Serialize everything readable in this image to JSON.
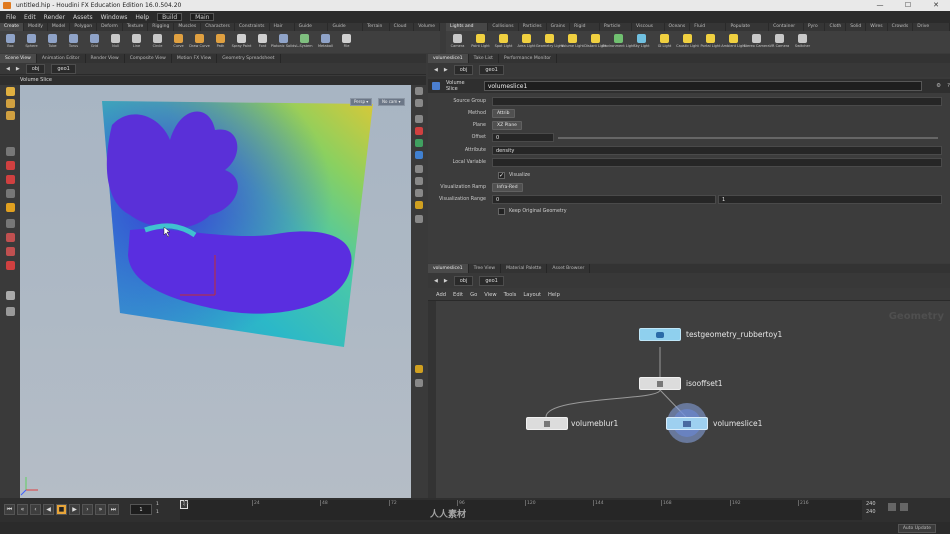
{
  "window": {
    "title": "untitled.hip - Houdini FX Education Edition 16.0.504.20",
    "controls": [
      "—",
      "☐",
      "✕"
    ]
  },
  "menu": {
    "items": [
      "File",
      "Edit",
      "Render",
      "Assets",
      "Windows",
      "Help"
    ],
    "build_field": "Build",
    "main_field": "Main"
  },
  "shelf_tabs_left": [
    "Create",
    "Modify",
    "Model",
    "Polygon",
    "Deform",
    "Texture",
    "Rigging",
    "Muscles",
    "Characters",
    "Constraints",
    "Hair Utils",
    "Guide Process",
    "Guide Brushes",
    "Terrain FX",
    "Cloud FX",
    "Volume"
  ],
  "shelf_tools_left": [
    {
      "label": "Box",
      "color": "#8fa3c8"
    },
    {
      "label": "Sphere",
      "color": "#8fa3c8"
    },
    {
      "label": "Tube",
      "color": "#8fa3c8"
    },
    {
      "label": "Torus",
      "color": "#8fa3c8"
    },
    {
      "label": "Grid",
      "color": "#8fa3c8"
    },
    {
      "label": "Null",
      "color": "#c8c8c8"
    },
    {
      "label": "Line",
      "color": "#c8c8c8"
    },
    {
      "label": "Circle",
      "color": "#c8c8c8"
    },
    {
      "label": "Curve",
      "color": "#e0a040"
    },
    {
      "label": "Draw Curve",
      "color": "#e0a040"
    },
    {
      "label": "Path",
      "color": "#e0a040"
    },
    {
      "label": "Spray Paint",
      "color": "#d0d0d0"
    },
    {
      "label": "Font",
      "color": "#d0d0d0"
    },
    {
      "label": "Platonic Solids",
      "color": "#8fa3c8"
    },
    {
      "label": "L-System",
      "color": "#7fbf7f"
    },
    {
      "label": "Metaball",
      "color": "#8fa3c8"
    },
    {
      "label": "File",
      "color": "#d0d0d0"
    }
  ],
  "shelf_tabs_right": [
    "Lights and Cameras",
    "Collisions",
    "Particles",
    "Grains",
    "Rigid Bodies",
    "Particle Fluids",
    "Viscous Fluids",
    "Oceans",
    "Fluid Containers",
    "Populate Containers",
    "Container Tools",
    "Pyro FX",
    "Cloth",
    "Solid",
    "Wires",
    "Crowds",
    "Drive Simulation"
  ],
  "shelf_tools_right": [
    {
      "label": "Camera",
      "color": "#c8c8c8"
    },
    {
      "label": "Point Light",
      "color": "#f0d040"
    },
    {
      "label": "Spot Light",
      "color": "#f0d040"
    },
    {
      "label": "Area Light",
      "color": "#f0d040"
    },
    {
      "label": "Geometry Light",
      "color": "#f0d040"
    },
    {
      "label": "Volume Light",
      "color": "#f0d040"
    },
    {
      "label": "Distant Light",
      "color": "#f0d040"
    },
    {
      "label": "Environment Light",
      "color": "#70c070"
    },
    {
      "label": "Sky Light",
      "color": "#70c0e0"
    },
    {
      "label": "GI Light",
      "color": "#f0d040"
    },
    {
      "label": "Caustic Light",
      "color": "#f0d040"
    },
    {
      "label": "Portal Light",
      "color": "#f0d040"
    },
    {
      "label": "Ambient Light",
      "color": "#f0d040"
    },
    {
      "label": "Stereo Camera",
      "color": "#c8c8c8"
    },
    {
      "label": "VR Camera",
      "color": "#c8c8c8"
    },
    {
      "label": "Switcher",
      "color": "#c8c8c8"
    }
  ],
  "left_pane": {
    "tabs": [
      "Scene View",
      "Animation Editor",
      "Render View",
      "Composite View",
      "Motion FX View",
      "Geometry Spreadsheet"
    ],
    "path": [
      "obj",
      "geo1"
    ],
    "viewport_title": "Volume Slice",
    "view_menu": "Persp ▾",
    "cam_menu": "No cam ▾"
  },
  "right_pane": {
    "tabs": [
      "volumeslice1",
      "Take List",
      "Performance Monitor"
    ],
    "path": [
      "obj",
      "geo1"
    ],
    "node_type": "Volume Slice",
    "node_name": "volumeslice1",
    "params": {
      "source_group_label": "Source Group",
      "source_group_value": "",
      "method_label": "Method",
      "method_value": "Attrib",
      "plane_label": "Plane",
      "plane_value": "XZ Plane",
      "offset_label": "Offset",
      "offset_value": "0",
      "attribute_label": "Attribute",
      "attribute_value": "density",
      "local_variable_label": "Local Variable",
      "local_variable_value": "",
      "visualize_label": "Visualize",
      "visualization_ramp_label": "Visualization Ramp",
      "visualization_ramp_value": "Infra-Red",
      "visualization_range_label": "Visualization Range",
      "range_min": "0",
      "range_max": "1",
      "keep_original_label": "Keep Original Geometry"
    }
  },
  "network_pane": {
    "tabs": [
      "volumeslice1",
      "Tree View",
      "Material Palette",
      "Asset Browser"
    ],
    "path": [
      "obj",
      "geo1"
    ],
    "menu": [
      "Add",
      "Edit",
      "Go",
      "View",
      "Tools",
      "Layout",
      "Help"
    ],
    "context_label": "Geometry",
    "nodes": [
      {
        "name": "testgeometry_rubbertoy1",
        "color": "#8fd0ee"
      },
      {
        "name": "isooffset1",
        "color": "#dcdcdc"
      },
      {
        "name": "volumeblur1",
        "color": "#dcdcdc"
      },
      {
        "name": "volumeslice1",
        "color": "#9ed0f0"
      }
    ]
  },
  "timeline": {
    "current_frame": "1",
    "cursor_frame": "1",
    "ticks": [
      "1",
      "24",
      "48",
      "72",
      "96",
      "120",
      "144",
      "168",
      "192",
      "216"
    ],
    "end_frame": "240",
    "end_frame2": "240",
    "start_small": "1",
    "start_small2": "1"
  },
  "status": {
    "update_mode": "Auto Update"
  },
  "watermark": "人人素材"
}
